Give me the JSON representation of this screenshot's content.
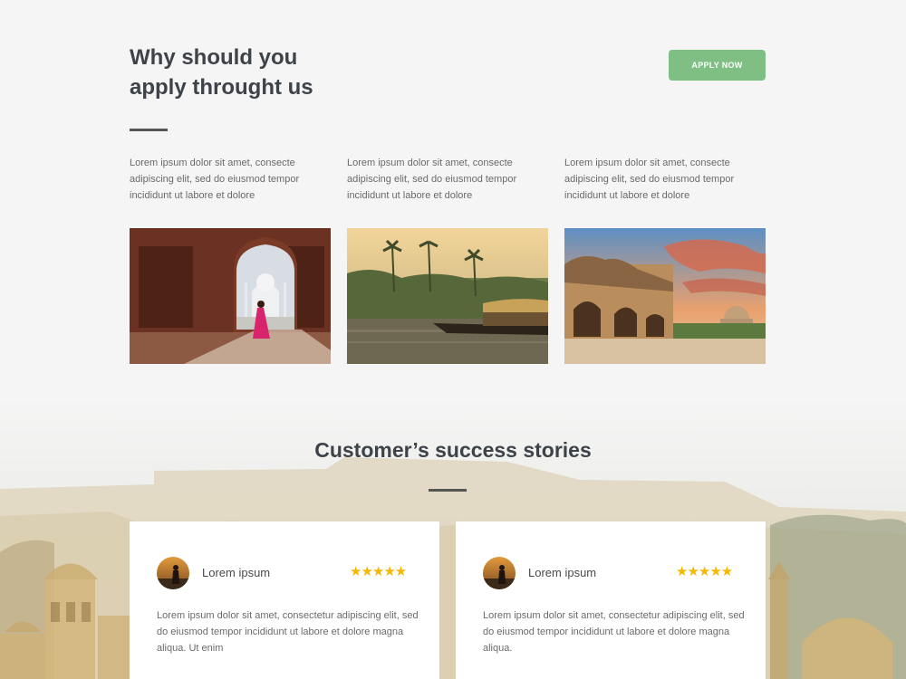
{
  "header": {
    "title_line1": "Why should you",
    "title_line2": "apply throught us",
    "apply_label": "APPLY NOW"
  },
  "features": [
    {
      "text": "Lorem ipsum dolor sit amet, consecte adipiscing elit, sed do eiusmod tempor incididunt ut labore et dolore"
    },
    {
      "text": "Lorem ipsum dolor sit amet, consecte adipiscing elit, sed do eiusmod tempor incididunt ut labore et dolore"
    },
    {
      "text": "Lorem ipsum dolor sit amet, consecte adipiscing elit, sed do eiusmod tempor incididunt ut labore et dolore"
    }
  ],
  "photos": [
    {
      "icon": "taj-mahal-archway-photo"
    },
    {
      "icon": "backwater-houseboat-photo"
    },
    {
      "icon": "fort-sunset-photo"
    }
  ],
  "stories": {
    "title": "Customer’s success stories",
    "cards": [
      {
        "name": "Lorem ipsum",
        "rating_stars": "★★★★★",
        "rating": 5,
        "text": "Lorem ipsum dolor sit amet, consectetur adipiscing elit, sed do eiusmod tempor incididunt ut labore et dolore magna aliqua. Ut enim"
      },
      {
        "name": "Lorem ipsum",
        "rating_stars": "★★★★★",
        "rating": 5,
        "text": "Lorem ipsum dolor sit amet, consectetur adipiscing elit, sed do eiusmod tempor incididunt ut labore et dolore magna aliqua."
      }
    ]
  },
  "colors": {
    "background": "#f5f5f5",
    "accent_green": "#7fbf84",
    "heading": "#3e4349",
    "star": "#f5b800"
  }
}
